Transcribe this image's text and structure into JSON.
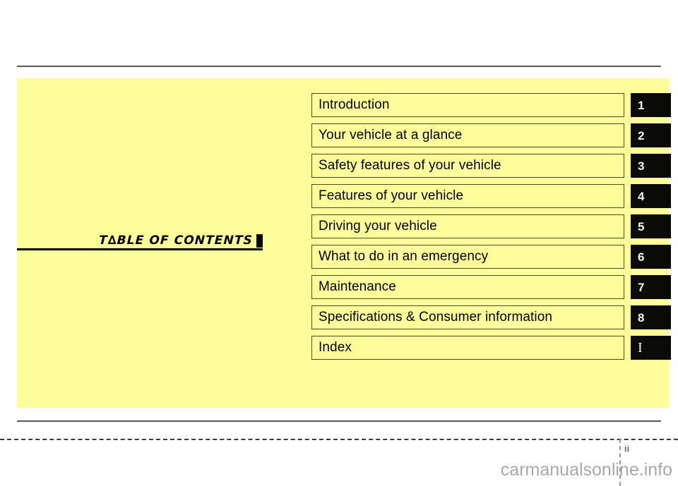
{
  "document": {
    "section_title": "T∆BLE  OF  CONTENTS",
    "page_number": "ii",
    "watermark": "carmanualsonline.info",
    "panel_color": "#fdfd99",
    "tab_color": "#0a0a08",
    "tab_text_color": "#f2f2f2",
    "rule_color": "#55555a"
  },
  "toc": {
    "entries": [
      {
        "label": "Introduction",
        "tab": "1"
      },
      {
        "label": "Your vehicle at a glance",
        "tab": "2"
      },
      {
        "label": "Safety features of your vehicle",
        "tab": "3"
      },
      {
        "label": "Features of your vehicle",
        "tab": "4"
      },
      {
        "label": "Driving your vehicle",
        "tab": "5"
      },
      {
        "label": "What to do in an emergency",
        "tab": "6"
      },
      {
        "label": "Maintenance",
        "tab": "7"
      },
      {
        "label": "Specifications & Consumer information",
        "tab": "8"
      },
      {
        "label": "Index",
        "tab": "I"
      }
    ]
  }
}
